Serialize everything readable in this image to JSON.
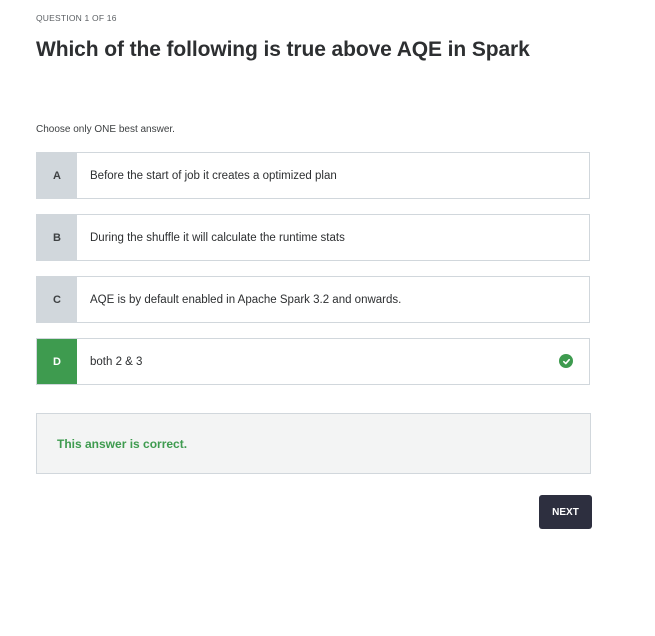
{
  "quiz": {
    "counter": "QUESTION 1 OF 16",
    "question": "Which of the following is true above AQE in Spark",
    "instruction": "Choose only ONE best answer.",
    "options": [
      {
        "letter": "A",
        "text": "Before the start of job it creates a optimized plan"
      },
      {
        "letter": "B",
        "text": "During the shuffle it will calculate the runtime stats"
      },
      {
        "letter": "C",
        "text": "AQE is by default enabled in Apache Spark 3.2 and onwards."
      },
      {
        "letter": "D",
        "text": "both 2 & 3"
      }
    ],
    "selected_option": "D",
    "feedback": "This answer is correct.",
    "next_label": "NEXT"
  },
  "colors": {
    "correct": "#3e9b4f",
    "letter_bg": "#d1d7dc",
    "button_bg": "#2d2f3f",
    "feedback_bg": "#f3f4f4"
  },
  "icons": {
    "correct_indicator": "check-circle-icon"
  }
}
